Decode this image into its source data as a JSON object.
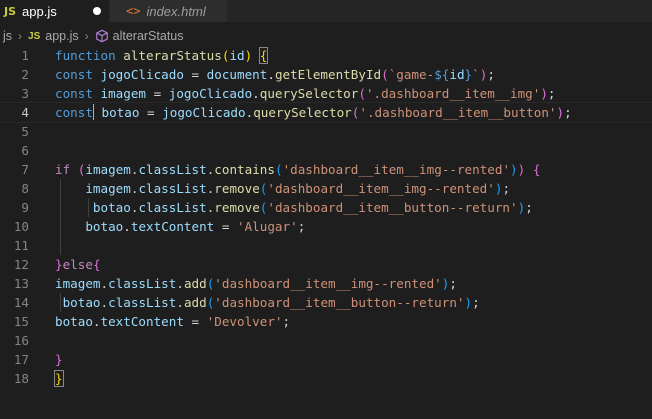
{
  "tabs": [
    {
      "icon": "JS",
      "label": "app.js",
      "state": "active",
      "modified": true
    },
    {
      "icon": "<>",
      "label": "index.html",
      "state": "inactive"
    }
  ],
  "breadcrumb": {
    "folder": "js",
    "file_icon": "JS",
    "file": "app.js",
    "symbol": "alterarStatus"
  },
  "editor": {
    "current_line": 4,
    "line_numbers": [
      "1",
      "2",
      "3",
      "4",
      "5",
      "6",
      "7",
      "8",
      "9",
      "10",
      "11",
      "12",
      "13",
      "14",
      "15",
      "16",
      "17",
      "18"
    ],
    "lines": [
      {
        "tokens": [
          {
            "t": "function",
            "c": "kw"
          },
          {
            "t": " ",
            "c": "punc"
          },
          {
            "t": "alterarStatus",
            "c": "fn"
          },
          {
            "t": "(",
            "c": "b1"
          },
          {
            "t": "id",
            "c": "var"
          },
          {
            "t": ")",
            "c": "b1"
          },
          {
            "t": " ",
            "c": "punc"
          },
          {
            "t": "{",
            "c": "b1 hl"
          }
        ]
      },
      {
        "tokens": [
          {
            "t": "const",
            "c": "kw"
          },
          {
            "t": " ",
            "c": "punc"
          },
          {
            "t": "jogoClicado",
            "c": "var"
          },
          {
            "t": " = ",
            "c": "punc"
          },
          {
            "t": "document",
            "c": "var"
          },
          {
            "t": ".",
            "c": "punc"
          },
          {
            "t": "getElementById",
            "c": "fn"
          },
          {
            "t": "(",
            "c": "b2"
          },
          {
            "t": "`game-",
            "c": "str"
          },
          {
            "t": "${",
            "c": "kw"
          },
          {
            "t": "id",
            "c": "var"
          },
          {
            "t": "}",
            "c": "kw"
          },
          {
            "t": "`",
            "c": "str"
          },
          {
            "t": ")",
            "c": "b2"
          },
          {
            "t": ";",
            "c": "punc"
          }
        ]
      },
      {
        "tokens": [
          {
            "t": "const",
            "c": "kw"
          },
          {
            "t": " ",
            "c": "punc"
          },
          {
            "t": "imagem",
            "c": "var"
          },
          {
            "t": " = ",
            "c": "punc"
          },
          {
            "t": "jogoClicado",
            "c": "var"
          },
          {
            "t": ".",
            "c": "punc"
          },
          {
            "t": "querySelector",
            "c": "fn"
          },
          {
            "t": "(",
            "c": "b2"
          },
          {
            "t": "'.dashboard__item__img'",
            "c": "str"
          },
          {
            "t": ")",
            "c": "b2"
          },
          {
            "t": ";",
            "c": "punc"
          }
        ]
      },
      {
        "tokens": [
          {
            "t": "const",
            "c": "kw"
          },
          {
            "t": "|",
            "c": "cursor"
          },
          {
            "t": " ",
            "c": "punc"
          },
          {
            "t": "botao",
            "c": "var"
          },
          {
            "t": " = ",
            "c": "punc"
          },
          {
            "t": "jogoClicado",
            "c": "var"
          },
          {
            "t": ".",
            "c": "punc"
          },
          {
            "t": "querySelector",
            "c": "fn"
          },
          {
            "t": "(",
            "c": "b2"
          },
          {
            "t": "'.dashboard__item__button'",
            "c": "str"
          },
          {
            "t": ")",
            "c": "b2"
          },
          {
            "t": ";",
            "c": "punc"
          }
        ]
      },
      {
        "tokens": []
      },
      {
        "tokens": []
      },
      {
        "tokens": [
          {
            "t": "if",
            "c": "ctl"
          },
          {
            "t": " ",
            "c": "punc"
          },
          {
            "t": "(",
            "c": "b2"
          },
          {
            "t": "imagem",
            "c": "var"
          },
          {
            "t": ".",
            "c": "punc"
          },
          {
            "t": "classList",
            "c": "var"
          },
          {
            "t": ".",
            "c": "punc"
          },
          {
            "t": "contains",
            "c": "fn"
          },
          {
            "t": "(",
            "c": "b3"
          },
          {
            "t": "'dashboard__item__img--rented'",
            "c": "str"
          },
          {
            "t": ")",
            "c": "b3"
          },
          {
            "t": ")",
            "c": "b2"
          },
          {
            "t": " ",
            "c": "punc"
          },
          {
            "t": "{",
            "c": "b2"
          }
        ]
      },
      {
        "tokens": [
          {
            "t": "    ",
            "c": "punc"
          },
          {
            "t": "imagem",
            "c": "var"
          },
          {
            "t": ".",
            "c": "punc"
          },
          {
            "t": "classList",
            "c": "var"
          },
          {
            "t": ".",
            "c": "punc"
          },
          {
            "t": "remove",
            "c": "fn"
          },
          {
            "t": "(",
            "c": "b3"
          },
          {
            "t": "'dashboard__item__img--rented'",
            "c": "str"
          },
          {
            "t": ")",
            "c": "b3"
          },
          {
            "t": ";",
            "c": "punc"
          }
        ]
      },
      {
        "tokens": [
          {
            "t": "     ",
            "c": "punc"
          },
          {
            "t": "botao",
            "c": "var"
          },
          {
            "t": ".",
            "c": "punc"
          },
          {
            "t": "classList",
            "c": "var"
          },
          {
            "t": ".",
            "c": "punc"
          },
          {
            "t": "remove",
            "c": "fn"
          },
          {
            "t": "(",
            "c": "b3"
          },
          {
            "t": "'dashboard__item__button--return'",
            "c": "str"
          },
          {
            "t": ")",
            "c": "b3"
          },
          {
            "t": ";",
            "c": "punc"
          }
        ]
      },
      {
        "tokens": [
          {
            "t": "    ",
            "c": "punc"
          },
          {
            "t": "botao",
            "c": "var"
          },
          {
            "t": ".",
            "c": "punc"
          },
          {
            "t": "textContent",
            "c": "var"
          },
          {
            "t": " = ",
            "c": "punc"
          },
          {
            "t": "'Alugar'",
            "c": "str"
          },
          {
            "t": ";",
            "c": "punc"
          }
        ]
      },
      {
        "tokens": []
      },
      {
        "tokens": [
          {
            "t": "}",
            "c": "b2"
          },
          {
            "t": "else",
            "c": "ctl"
          },
          {
            "t": "{",
            "c": "b2"
          }
        ]
      },
      {
        "tokens": [
          {
            "t": "imagem",
            "c": "var"
          },
          {
            "t": ".",
            "c": "punc"
          },
          {
            "t": "classList",
            "c": "var"
          },
          {
            "t": ".",
            "c": "punc"
          },
          {
            "t": "add",
            "c": "fn"
          },
          {
            "t": "(",
            "c": "b3"
          },
          {
            "t": "'dashboard__item__img--rented'",
            "c": "str"
          },
          {
            "t": ")",
            "c": "b3"
          },
          {
            "t": ";",
            "c": "punc"
          }
        ]
      },
      {
        "tokens": [
          {
            "t": " ",
            "c": "punc"
          },
          {
            "t": "botao",
            "c": "var"
          },
          {
            "t": ".",
            "c": "punc"
          },
          {
            "t": "classList",
            "c": "var"
          },
          {
            "t": ".",
            "c": "punc"
          },
          {
            "t": "add",
            "c": "fn"
          },
          {
            "t": "(",
            "c": "b3"
          },
          {
            "t": "'dashboard__item__button--return'",
            "c": "str"
          },
          {
            "t": ")",
            "c": "b3"
          },
          {
            "t": ";",
            "c": "punc"
          }
        ]
      },
      {
        "tokens": [
          {
            "t": "botao",
            "c": "var"
          },
          {
            "t": ".",
            "c": "punc"
          },
          {
            "t": "textContent",
            "c": "var"
          },
          {
            "t": " = ",
            "c": "punc"
          },
          {
            "t": "'Devolver'",
            "c": "str"
          },
          {
            "t": ";",
            "c": "punc"
          }
        ]
      },
      {
        "tokens": []
      },
      {
        "tokens": [
          {
            "t": "}",
            "c": "b2"
          }
        ]
      },
      {
        "tokens": [
          {
            "t": "}",
            "c": "b1 hl"
          }
        ]
      }
    ]
  },
  "colors": {
    "background": "#1e1e1e",
    "keyword": "#569cd6",
    "control": "#c586c0",
    "variable": "#9cdcfe",
    "function": "#dcdcaa",
    "string": "#ce9178",
    "bracket1": "#ffd700",
    "bracket2": "#da70d6",
    "bracket3": "#179fff"
  }
}
